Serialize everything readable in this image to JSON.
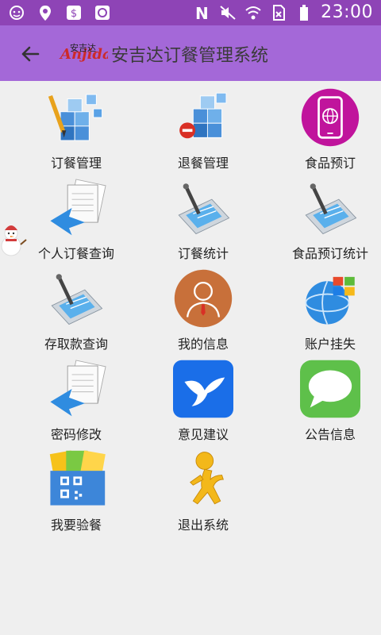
{
  "status_bar": {
    "time": "23:00",
    "icons": [
      "face-icon",
      "location-icon",
      "dollar-app-icon",
      "chat-app-icon",
      "nfc-icon",
      "mute-icon",
      "wifi-icon",
      "no-sim-icon",
      "battery-icon"
    ]
  },
  "app_bar": {
    "back_icon": "arrow-left-icon",
    "logo_text": "安吉达",
    "title": "安吉达订餐管理系统"
  },
  "menu": [
    {
      "label": "订餐管理",
      "icon": "cubes-pencil-icon"
    },
    {
      "label": "退餐管理",
      "icon": "cubes-minus-icon"
    },
    {
      "label": "食品预订",
      "icon": "phone-globe-icon"
    },
    {
      "label": "个人订餐查询",
      "icon": "documents-arrow-icon"
    },
    {
      "label": "订餐统计",
      "icon": "tablet-pen-icon"
    },
    {
      "label": "食品预订统计",
      "icon": "tablet-pen-icon"
    },
    {
      "label": "存取款查询",
      "icon": "tablet-pen-icon"
    },
    {
      "label": "我的信息",
      "icon": "user-avatar-icon"
    },
    {
      "label": "账户挂失",
      "icon": "globe-windows-icon"
    },
    {
      "label": "密码修改",
      "icon": "documents-arrow-icon"
    },
    {
      "label": "意见建议",
      "icon": "bird-icon"
    },
    {
      "label": "公告信息",
      "icon": "message-bubble-icon"
    },
    {
      "label": "我要验餐",
      "icon": "qr-code-icon"
    },
    {
      "label": "退出系统",
      "icon": "running-man-icon"
    }
  ],
  "colors": {
    "status_bar": "#8e44b6",
    "app_bar": "#a468d8",
    "background": "#efefef"
  }
}
